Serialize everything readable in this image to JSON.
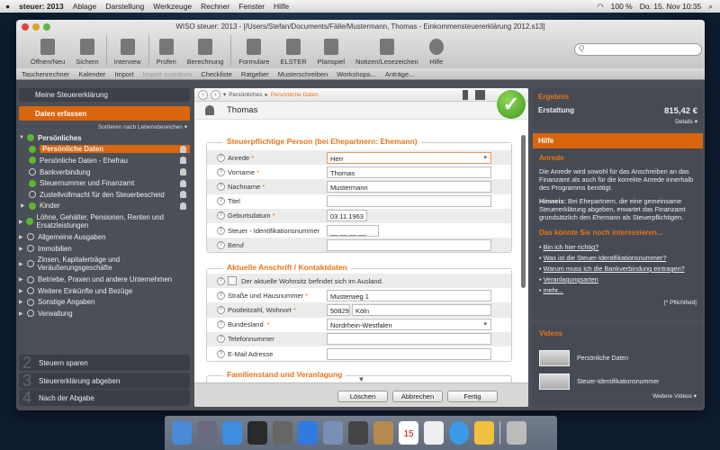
{
  "menubar": {
    "app": "steuer: 2013",
    "items": [
      "Ablage",
      "Darstellung",
      "Werkzeuge",
      "Rechner",
      "Fenster",
      "Hilfe"
    ],
    "battery": "100 %",
    "clock": "Do. 15. Nov  10:35"
  },
  "window": {
    "title": "WISO steuer: 2013 - [/Users/Stefan/Documents/Fälle/Mustermann, Thomas - Einkommensteuererklärung 2012.s13]"
  },
  "toolbar": [
    "Öffnen/Neu",
    "Sichern",
    "Interview",
    "Prüfen",
    "Berechnung",
    "Formulare",
    "ELSTER",
    "Planspiel",
    "Notizen/Lesezeichen",
    "Hilfe"
  ],
  "subbar": [
    "Taschenrechner",
    "Kalender",
    "Import",
    "Import zuordnen",
    "Checkliste",
    "Ratgeber",
    "Musterschreiben",
    "Workshops...",
    "Anträge..."
  ],
  "sidebar": {
    "header": "Meine Steuererklärung",
    "step1": "Daten erfassen",
    "step1_num": "1",
    "sort": "Sortieren nach Lebensbereichen ▾",
    "items": [
      "Persönliches",
      "Persönliche Daten",
      "Persönliche Daten - Ehefrau",
      "Bankverbindung",
      "Steuernummer und Finanzamt",
      "Zustellvollmacht für den Steuerbescheid",
      "Kinder",
      "Löhne, Gehälter, Pensionen, Renten und Ersatzleistungen",
      "Allgemeine Ausgaben",
      "Immobilien",
      "Zinsen, Kapitalerträge und Veräußerungsgeschäfte",
      "Betriebe, Praxen und andere Unternehmen",
      "Weitere Einkünfte und Bezüge",
      "Sonstige Angaben",
      "Verwaltung"
    ],
    "steps": [
      {
        "num": "2",
        "label": "Steuern sparen"
      },
      {
        "num": "3",
        "label": "Steuererklärung abgeben"
      },
      {
        "num": "4",
        "label": "Nach der Abgabe"
      }
    ]
  },
  "center": {
    "crumb1": "Persönliches",
    "crumb2": "Persönliche Daten",
    "person": "Thomas",
    "section1": "Steuerpflichtige Person (bei Ehepartnern: Ehemann)",
    "f": {
      "anrede": "Anrede",
      "anrede_v": "Herr",
      "vorname": "Vorname",
      "vorname_v": "Thomas",
      "nachname": "Nachname",
      "nachname_v": "Mustermann",
      "titel": "Titel",
      "geb": "Geburtsdatum",
      "geb_v": "03.11.1963",
      "idnr": "Steuer - Identifikationsnummer",
      "idnr_v": "__ __ __ __",
      "beruf": "Beruf"
    },
    "section2": "Aktuelle Anschrift / Kontaktdaten",
    "a": {
      "ausland": "Der aktuelle Wohnsitz befindet sich im Ausland.",
      "strasse": "Straße und Hausnummer",
      "strasse_v": "Musterweg 1",
      "plz": "Postleitzahl, Wohnort",
      "plz_v": "50829",
      "ort_v": "Köln",
      "land": "Bundesland",
      "land_v": "Nordrhein-Westfalen",
      "tel": "Telefonnummer",
      "mail": "E-Mail Adresse"
    },
    "section3": "Familienstand und Veranlagung",
    "req": "*",
    "q": "?",
    "buttons": {
      "delete": "Löschen",
      "cancel": "Abbrechen",
      "done": "Fertig"
    }
  },
  "right": {
    "ergebnis": "Ergebnis",
    "erstattung": "Erstattung",
    "amount": "815,42 €",
    "details": "Details ▾",
    "hilfe": "Hilfe",
    "topic": "Anrede",
    "p1": "Die Anrede wird sowohl für das Anschreiben an das Finanzamt als auch für die korrekte Anrede innerhalb des Programms benötigt.",
    "hinweis": "Hinweis:",
    "p2": " Bei Ehepartnern, die eine gemeinsame Steuererklärung abgeben, erwartet das Finanzamt grundsätzlich den Ehemann als Steuerpflichtigen.",
    "interest": "Das könnte Sie noch interessieren...",
    "links": [
      "Bin ich hier richtig?",
      "Was ist die Steuer-Identifikationsnummer?",
      "Warum muss ich die Bankverbindung eintragen?",
      "Veranlagungsarten",
      "mehr..."
    ],
    "pflicht": "[* Pflichtfeld]",
    "videos": "Videos",
    "video_items": [
      "Persönliche Daten",
      "Steuer-Identifikationsnummer"
    ],
    "more_videos": "Weitere Videos ▾"
  },
  "search": {
    "placeholder": "Q"
  },
  "calendar_day": "15"
}
